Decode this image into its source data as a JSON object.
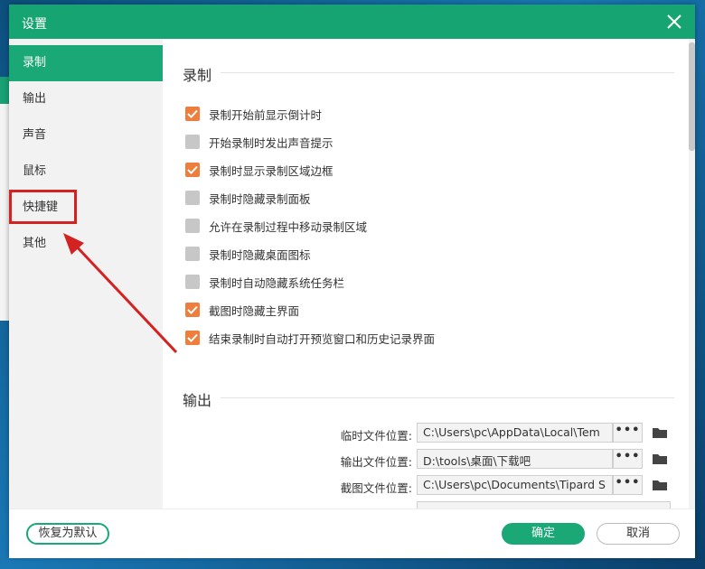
{
  "dialog": {
    "title": "设置"
  },
  "sidebar": {
    "items": [
      {
        "label": "录制"
      },
      {
        "label": "输出"
      },
      {
        "label": "声音"
      },
      {
        "label": "鼠标"
      },
      {
        "label": "快捷键"
      },
      {
        "label": "其他"
      }
    ]
  },
  "recording": {
    "title": "录制",
    "options": [
      {
        "label": "录制开始前显示倒计时",
        "checked": true
      },
      {
        "label": "开始录制时发出声音提示",
        "checked": false
      },
      {
        "label": "录制时显示录制区域边框",
        "checked": true
      },
      {
        "label": "录制时隐藏录制面板",
        "checked": false
      },
      {
        "label": "允许在录制过程中移动录制区域",
        "checked": false
      },
      {
        "label": "录制时隐藏桌面图标",
        "checked": false
      },
      {
        "label": "录制时自动隐藏系统任务栏",
        "checked": false
      },
      {
        "label": "截图时隐藏主界面",
        "checked": true
      },
      {
        "label": "结束录制时自动打开预览窗口和历史记录界面",
        "checked": true
      }
    ]
  },
  "output": {
    "title": "输出",
    "rows": [
      {
        "label": "临时文件位置:",
        "value": "C:\\Users\\pc\\AppData\\Local\\Tem",
        "button": "•••"
      },
      {
        "label": "输出文件位置:",
        "value": "D:\\tools\\桌面\\下载吧",
        "button": "•••"
      },
      {
        "label": "截图文件位置:",
        "value": "C:\\Users\\pc\\Documents\\Tipard S",
        "button": "•••"
      }
    ]
  },
  "footer": {
    "restore_label": "恢复为默认",
    "ok_label": "确定",
    "cancel_label": "取消"
  },
  "colors": {
    "accent": "#1aa876",
    "checkbox_on": "#ef7d3c",
    "checkbox_off": "#c7c7c7",
    "annotation": "#d42222"
  }
}
